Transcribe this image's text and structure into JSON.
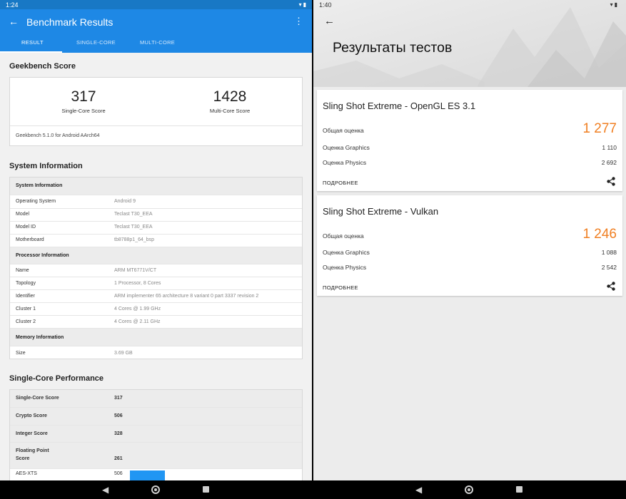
{
  "left": {
    "status_time": "1:24",
    "title": "Benchmark Results",
    "tabs": [
      "RESULT",
      "SINGLE-CORE",
      "MULTI-CORE"
    ],
    "geekbench": {
      "heading": "Geekbench Score",
      "single_value": "317",
      "single_label": "Single-Core Score",
      "multi_value": "1428",
      "multi_label": "Multi-Core Score",
      "version": "Geekbench 5.1.0 for Android AArch64"
    },
    "sysinfo": {
      "heading": "System Information",
      "rows": [
        {
          "k": "System Information",
          "v": ""
        },
        {
          "k": "Operating System",
          "v": "Android 9"
        },
        {
          "k": "Model",
          "v": "Teclast T30_EEA"
        },
        {
          "k": "Model ID",
          "v": "Teclast T30_EEA"
        },
        {
          "k": "Motherboard",
          "v": "tb8788p1_64_bsp"
        },
        {
          "k": "Processor Information",
          "v": ""
        },
        {
          "k": "Name",
          "v": "ARM MT6771V/CT"
        },
        {
          "k": "Topology",
          "v": "1 Processor, 8 Cores"
        },
        {
          "k": "Identifier",
          "v": "ARM implementer 65 architecture 8 variant 0 part 3337 revision 2"
        },
        {
          "k": "Cluster 1",
          "v": "4 Cores @ 1.99 GHz"
        },
        {
          "k": "Cluster 2",
          "v": "4 Cores @ 2.11 GHz"
        },
        {
          "k": "Memory Information",
          "v": ""
        },
        {
          "k": "Size",
          "v": "3.69 GB"
        }
      ]
    },
    "single_perf": {
      "heading": "Single-Core Performance",
      "rows": [
        {
          "k": "Single-Core Score",
          "v": "317"
        },
        {
          "k": "Crypto Score",
          "v": "506"
        },
        {
          "k": "Integer Score",
          "v": "328"
        },
        {
          "k": "Floating Point",
          "k2": "Score",
          "v": "261"
        },
        {
          "k": "AES-XTS",
          "v": "506"
        }
      ]
    }
  },
  "right": {
    "status_time": "1:40",
    "title": "Результаты тестов",
    "benchmarks": [
      {
        "name": "Sling Shot Extreme - OpenGL ES 3.1",
        "overall_label": "Общая оценка",
        "overall_value": "1 277",
        "graphics_label": "Оценка Graphics",
        "graphics_value": "1 110",
        "physics_label": "Оценка Physics",
        "physics_value": "2 692",
        "more_label": "ПОДРОБНЕЕ"
      },
      {
        "name": "Sling Shot Extreme - Vulkan",
        "overall_label": "Общая оценка",
        "overall_value": "1 246",
        "graphics_label": "Оценка Graphics",
        "graphics_value": "1 088",
        "physics_label": "Оценка Physics",
        "physics_value": "2 542",
        "more_label": "ПОДРОБНЕЕ"
      }
    ]
  },
  "colors": {
    "primary_blue": "#1e88e5",
    "accent_orange": "#f07f22",
    "bar_blue": "#2196f3"
  },
  "icons": [
    "back-arrow-icon",
    "more-vert-icon",
    "wifi-icon",
    "battery-icon",
    "share-icon",
    "nav-back-icon",
    "nav-home-icon",
    "nav-recents-icon"
  ]
}
